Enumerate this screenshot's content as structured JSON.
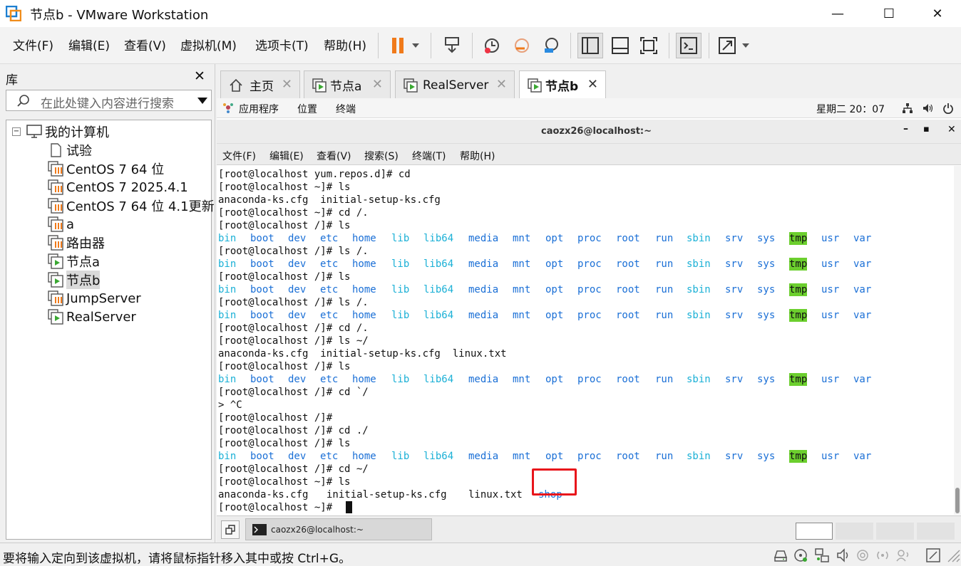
{
  "window": {
    "title": "节点b - VMware Workstation"
  },
  "menu": [
    "文件(F)",
    "编辑(E)",
    "查看(V)",
    "虚拟机(M)",
    "选项卡(T)",
    "帮助(H)"
  ],
  "library": {
    "title": "库",
    "search_placeholder": "在此处键入内容进行搜索",
    "root": "我的计算机",
    "items": [
      "试验",
      "CentOS 7 64 位",
      "CentOS 7 2025.4.1",
      "CentOS 7 64 位 4.1更新",
      "a",
      "路由器",
      "节点a",
      "节点b",
      "JumpServer",
      "RealServer"
    ],
    "selected": "节点b"
  },
  "tabs": [
    "主页",
    "节点a",
    "RealServer",
    "节点b"
  ],
  "active_tab": "节点b",
  "guest": {
    "top_bar": {
      "applications": "应用程序",
      "places": "位置",
      "terminal": "终端",
      "clock": "星期二 20：07"
    },
    "terminal_title": "caozx26@localhost:~",
    "terminal_menu": [
      "文件(F)",
      "编辑(E)",
      "查看(V)",
      "搜索(S)",
      "终端(T)",
      "帮助(H)"
    ],
    "dirs": [
      "bin",
      "boot",
      "dev",
      "etc",
      "home",
      "lib",
      "lib64",
      "media",
      "mnt",
      "opt",
      "proc",
      "root",
      "run",
      "sbin",
      "srv",
      "sys",
      "tmp",
      "usr",
      "var"
    ],
    "lines": [
      "[root@localhost yum.repos.d]# cd",
      "[root@localhost ~]# ls",
      "anaconda-ks.cfg  initial-setup-ks.cfg",
      "[root@localhost ~]# cd /.",
      "[root@localhost /]# ls",
      "__DIRS__",
      "[root@localhost /]# ls /.",
      "__DIRS__",
      "[root@localhost /]# ls",
      "__DIRS__",
      "[root@localhost /]# ls /.",
      "__DIRS__",
      "[root@localhost /]# cd /.",
      "[root@localhost /]# ls ~/",
      "anaconda-ks.cfg  initial-setup-ks.cfg  linux.txt",
      "[root@localhost /]# ls",
      "__DIRS__",
      "[root@localhost /]# cd `/",
      "> ^C",
      "[root@localhost /]#",
      "[root@localhost /]# cd ./",
      "[root@localhost /]# ls",
      "__DIRS__",
      "[root@localhost /]# cd ~/",
      "[root@localhost ~]# ls",
      "__HOME__",
      "[root@localhost ~]# "
    ],
    "home_files": [
      "anaconda-ks.cfg",
      "initial-setup-ks.cfg",
      "linux.txt"
    ],
    "home_new_dir": "shop",
    "taskbar_item": "caozx26@localhost:~"
  },
  "status": {
    "text": "要将输入定向到该虚拟机，请将鼠标指针移入其中或按 Ctrl+G。"
  },
  "colors": {
    "dir": "#1a6fd6",
    "cyan": "#1ab0d6",
    "tmp_bg": "#6ccf2e",
    "highlight": "#e8151b",
    "pause": "#f07a1a"
  }
}
